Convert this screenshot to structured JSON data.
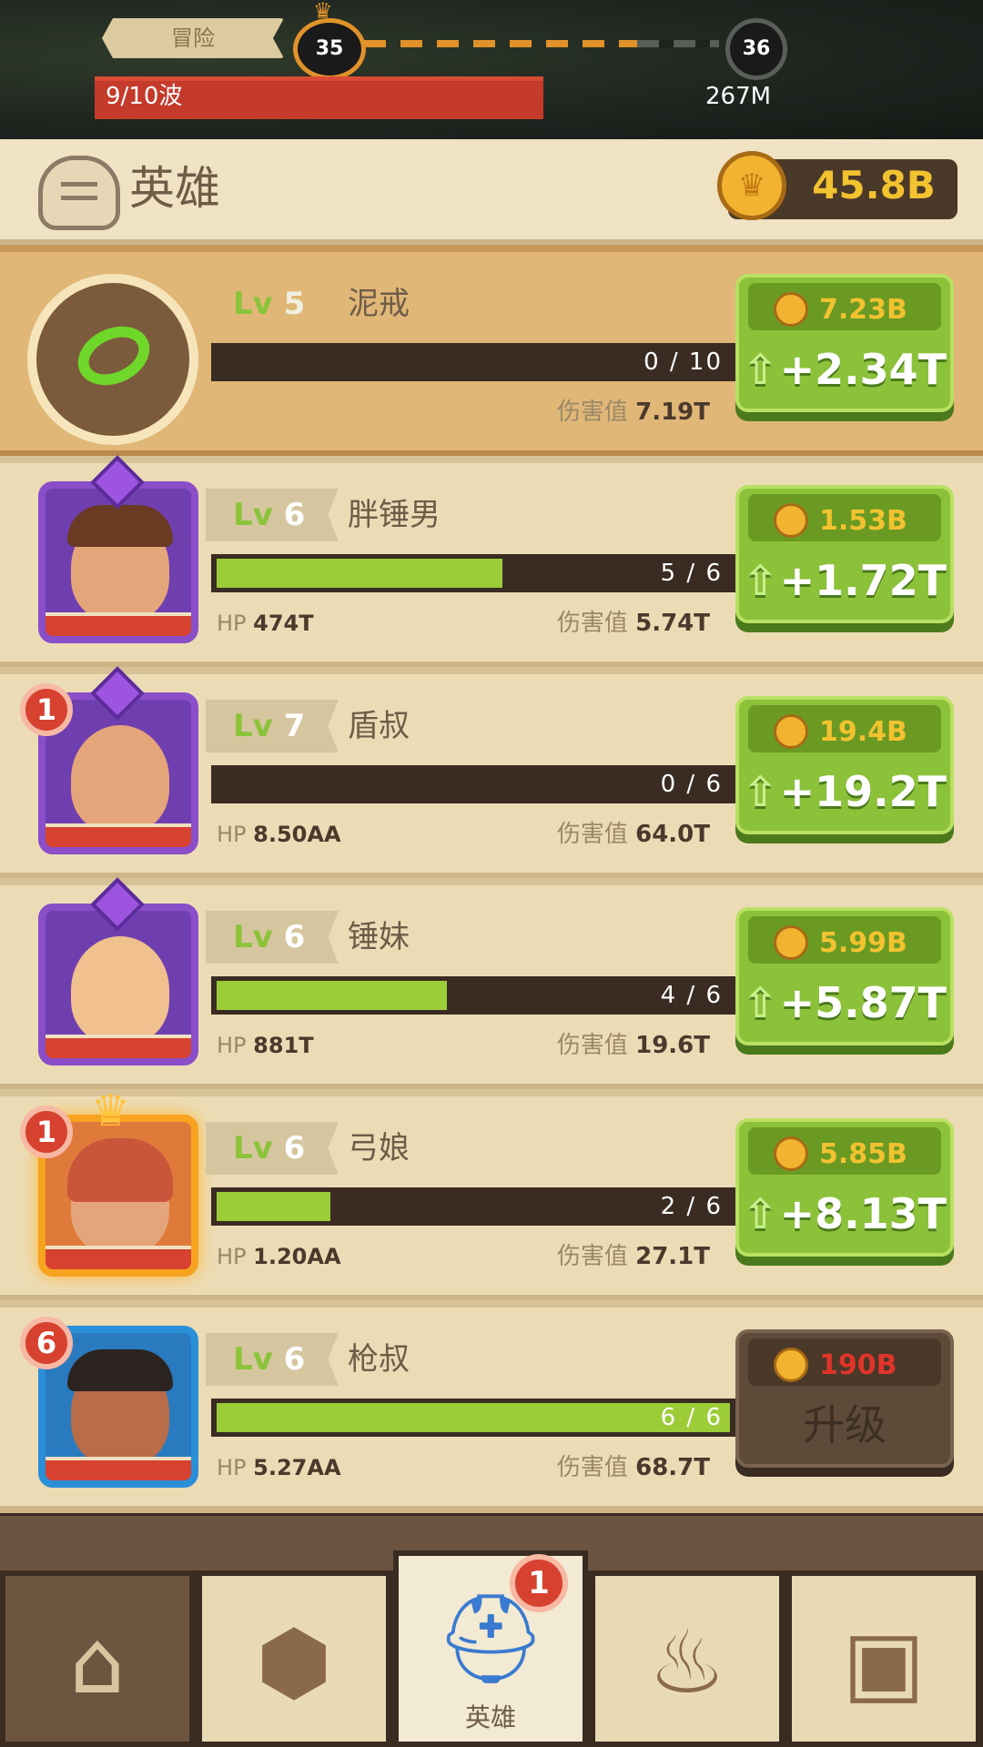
{
  "topbar": {
    "mode_label": "冒险",
    "current_stage": "35",
    "next_stage": "36",
    "wave_label": "9/10波",
    "wave_progress": 0.9,
    "total_hp": "267M"
  },
  "header": {
    "title": "英雄",
    "gold": "45.8B"
  },
  "colors": {
    "accent_green": "#8cc13a",
    "gold": "#f2c230",
    "alert_red": "#d7412f"
  },
  "items": [
    {
      "type": "ring",
      "icon": "ring-icon",
      "lv_label": "Lv",
      "level": "5",
      "name": "泥戒",
      "xp_text": "0 / 10",
      "xp_fraction": 0,
      "hp_label": "",
      "hp": "",
      "dmg_label": "伤害值",
      "dmg": "7.19T",
      "cost": "7.23B",
      "gain": "+2.34T"
    },
    {
      "type": "hero",
      "frame": "purple",
      "lv_label": "Lv",
      "level": "6",
      "name": "胖锤男",
      "xp_text": "5 / 6",
      "xp_fraction": 0.83,
      "hp_label": "HP",
      "hp": "474T",
      "dmg_label": "伤害值",
      "dmg": "5.74T",
      "cost": "1.53B",
      "gain": "+1.72T"
    },
    {
      "type": "hero",
      "frame": "purple",
      "badge": "1",
      "lv_label": "Lv",
      "level": "7",
      "name": "盾叔",
      "xp_text": "0 / 6",
      "xp_fraction": 0,
      "hp_label": "HP",
      "hp": "8.50AA",
      "dmg_label": "伤害值",
      "dmg": "64.0T",
      "cost": "19.4B",
      "gain": "+19.2T"
    },
    {
      "type": "hero",
      "frame": "purple",
      "lv_label": "Lv",
      "level": "6",
      "name": "锤妹",
      "xp_text": "4 / 6",
      "xp_fraction": 0.67,
      "hp_label": "HP",
      "hp": "881T",
      "dmg_label": "伤害值",
      "dmg": "19.6T",
      "cost": "5.99B",
      "gain": "+5.87T"
    },
    {
      "type": "hero",
      "frame": "gold",
      "badge": "1",
      "lv_label": "Lv",
      "level": "6",
      "name": "弓娘",
      "xp_text": "2 / 6",
      "xp_fraction": 0.33,
      "hp_label": "HP",
      "hp": "1.20AA",
      "dmg_label": "伤害值",
      "dmg": "27.1T",
      "cost": "5.85B",
      "gain": "+8.13T"
    },
    {
      "type": "hero",
      "frame": "blue",
      "badge": "6",
      "lv_label": "Lv",
      "level": "6",
      "name": "枪叔",
      "xp_text": "6 / 6",
      "xp_fraction": 1,
      "hp_label": "HP",
      "hp": "5.27AA",
      "dmg_label": "伤害值",
      "dmg": "68.7T",
      "cost": "190B",
      "gain": "升级",
      "locked": true
    }
  ],
  "nav": [
    {
      "name": "nav-home",
      "icon": "tent-icon",
      "label": ""
    },
    {
      "name": "nav-rune",
      "icon": "rune-stone-icon",
      "label": ""
    },
    {
      "name": "nav-heroes",
      "icon": "knight-helmet-icon",
      "label": "英雄",
      "badge": "1",
      "active": true
    },
    {
      "name": "nav-cauldron",
      "icon": "cauldron-icon",
      "label": ""
    },
    {
      "name": "nav-chest",
      "icon": "treasure-chest-icon",
      "label": ""
    }
  ]
}
